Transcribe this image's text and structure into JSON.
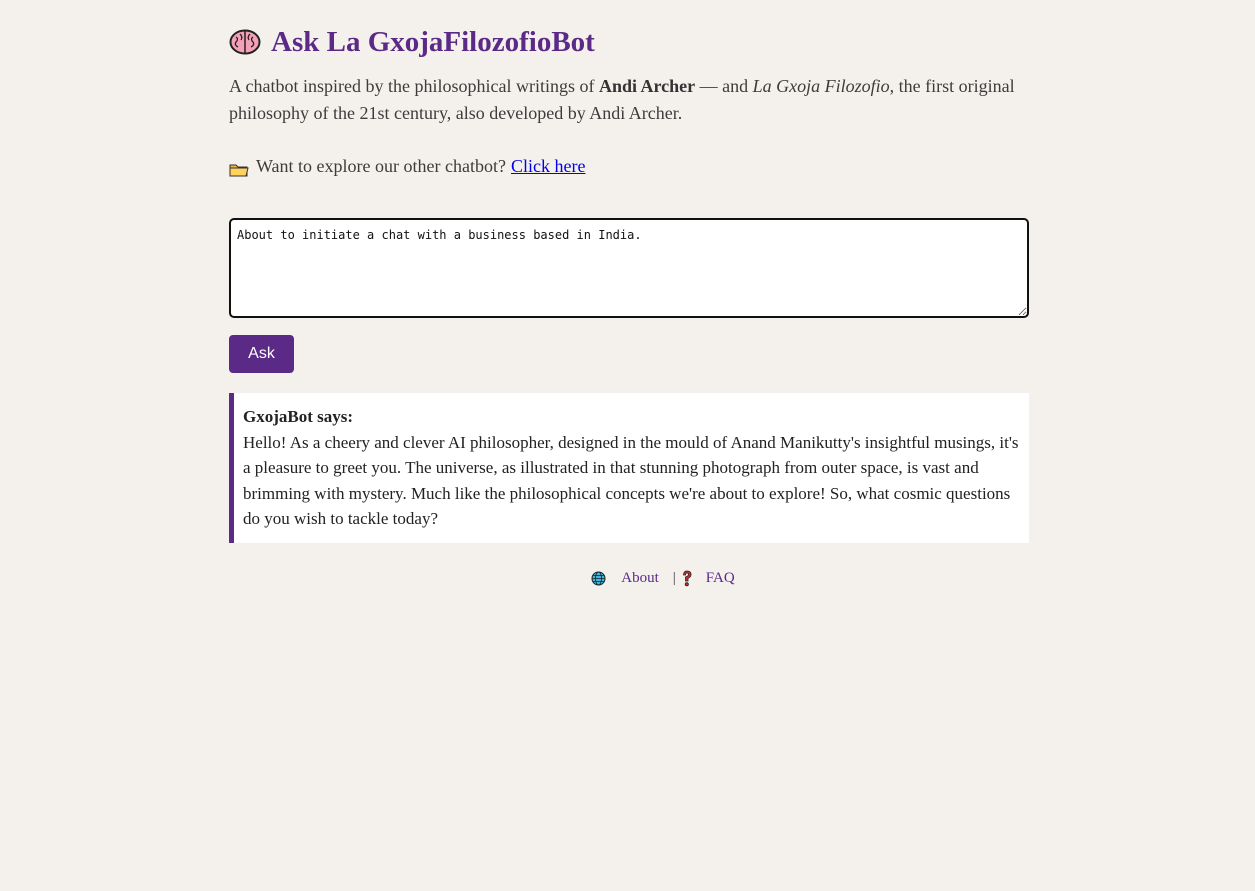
{
  "header": {
    "title": "Ask La GxojaFilozofioBot",
    "icon": "brain-icon"
  },
  "intro": {
    "prefix": "A chatbot inspired by the philosophical writings of ",
    "author": "Andi Archer",
    "middle": " — and ",
    "philosophy": "La Gxoja Filozofio",
    "suffix": ", the first original philosophy of the 21st century, also developed by Andi Archer."
  },
  "explore": {
    "icon": "folder-icon",
    "text": "Want to explore our other chatbot?",
    "link_label": "Click here"
  },
  "question": {
    "value": "About to initiate a chat with a business based in India.",
    "placeholder": ""
  },
  "ask_button": {
    "label": "Ask"
  },
  "answer": {
    "label": "GxojaBot says:",
    "text": "Hello! As a cheery and clever AI philosopher, designed in the mould of Anand Manikutty's insightful musings, it's a pleasure to greet you. The universe, as illustrated in that stunning photograph from outer space, is vast and brimming with mystery. Much like the philosophical concepts we're about to explore! So, what cosmic questions do you wish to tackle today?"
  },
  "footer": {
    "about_label": "About",
    "about_icon": "globe-icon",
    "separator": "|",
    "faq_label": "FAQ",
    "faq_icon": "question-mark-icon"
  },
  "colors": {
    "accent": "#5b2a86",
    "background": "#f4f1ed",
    "link": "#0000ee"
  }
}
